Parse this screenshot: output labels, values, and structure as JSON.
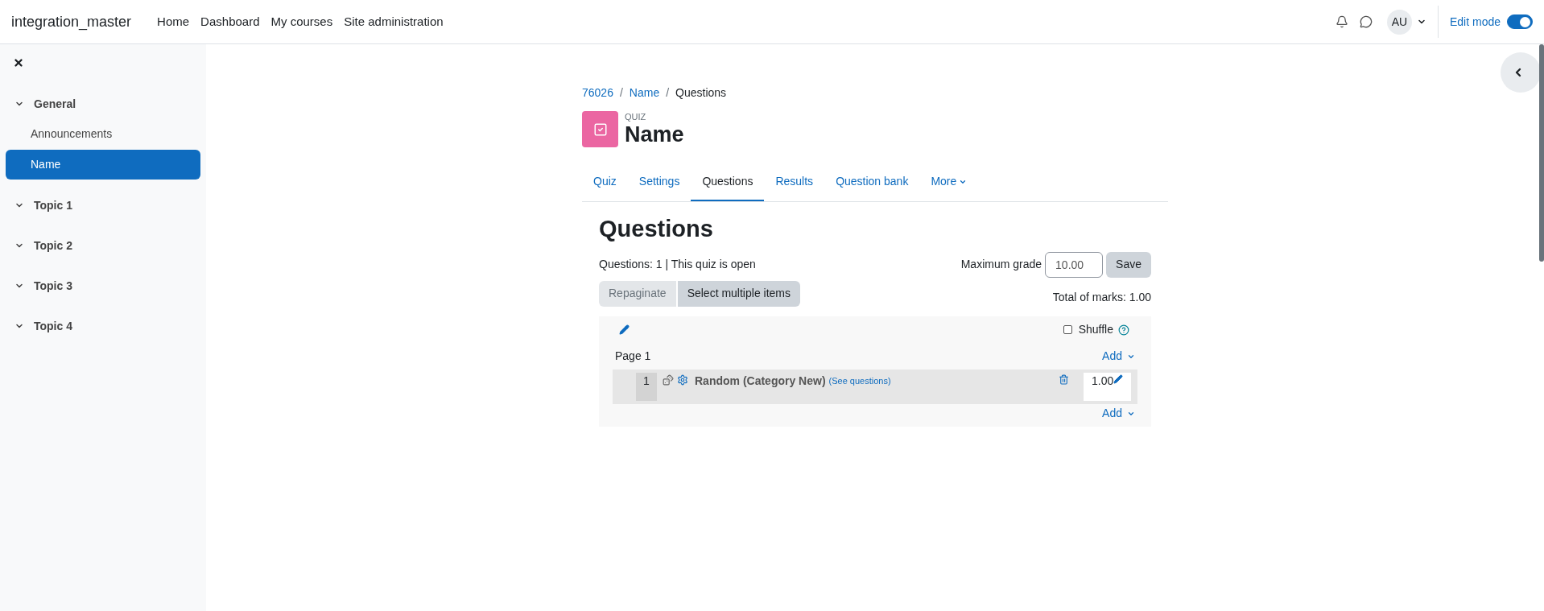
{
  "header": {
    "site_name": "integration_master",
    "nav": [
      "Home",
      "Dashboard",
      "My courses",
      "Site administration"
    ],
    "avatar": "AU",
    "edit_mode": {
      "label": "Edit mode",
      "on": true
    }
  },
  "sidebar": {
    "sections": [
      {
        "title": "General",
        "children": [
          {
            "label": "Announcements",
            "selected": false
          },
          {
            "label": "Name",
            "selected": true
          }
        ]
      },
      {
        "title": "Topic 1"
      },
      {
        "title": "Topic 2"
      },
      {
        "title": "Topic 3"
      },
      {
        "title": "Topic 4"
      }
    ]
  },
  "breadcrumb": [
    {
      "label": "76026",
      "link": true
    },
    {
      "separator": "/",
      "label": "Name",
      "link": true
    },
    {
      "separator": "/",
      "label": "Questions",
      "link": false
    }
  ],
  "activity": {
    "type_label": "QUIZ",
    "title": "Name"
  },
  "tabs": [
    {
      "label": "Quiz",
      "selected": false
    },
    {
      "label": "Settings",
      "selected": false
    },
    {
      "label": "Questions",
      "selected": true
    },
    {
      "label": "Results",
      "selected": false
    },
    {
      "label": "Question bank",
      "selected": false
    },
    {
      "label": "More",
      "selected": false
    }
  ],
  "heading": "Questions",
  "status": "Questions: 1 | This quiz is open",
  "max_grade": {
    "label": "Maximum grade",
    "value": "10.00",
    "button": "Save"
  },
  "buttons": [
    {
      "label": "Repaginate",
      "disabled": true
    },
    {
      "label": "Select multiple items",
      "disabled": false
    }
  ],
  "total_marks": "Total of marks: 1.00",
  "shuffle": {
    "label": "Shuffle",
    "checked": false
  },
  "pages": [
    {
      "title": "Page 1",
      "add": "Add",
      "questions": [
        {
          "number": "1",
          "name": "Random (Category New)",
          "link": "(See questions)",
          "mark": "1.00"
        }
      ],
      "add_after": "Add"
    }
  ]
}
